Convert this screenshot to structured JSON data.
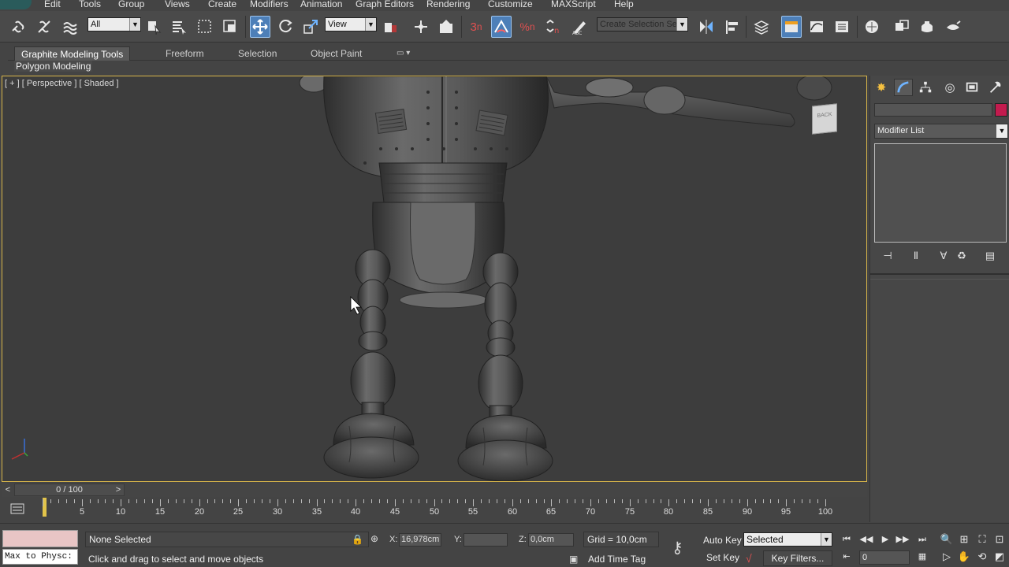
{
  "menu": {
    "items": [
      "Edit",
      "Tools",
      "Group",
      "Views",
      "Create",
      "Modifiers",
      "Animation",
      "Graph Editors",
      "Rendering",
      "Customize",
      "MAXScript",
      "Help"
    ]
  },
  "toolbar": {
    "selection_filter": "All",
    "ref_coord": "View",
    "named_selection": "Create Selection Se",
    "snap_label": "3",
    "angle_snap_label": "n",
    "percent_snap_label": "%"
  },
  "ribbon": {
    "tabs": [
      "Graphite Modeling Tools",
      "Freeform",
      "Selection",
      "Object Paint"
    ],
    "active_tab": "Graphite Modeling Tools",
    "sub_label": "Polygon Modeling"
  },
  "viewport": {
    "label": "[ + ] [ Perspective ] [ Shaded ]",
    "viewcube_face": "BACK"
  },
  "command_panel": {
    "modifier_list": "Modifier List",
    "color_swatch": "#c31b4e"
  },
  "timeslider": {
    "frame_display": "0 / 100",
    "prev": "<",
    "next": ">"
  },
  "trackbar": {
    "labels": [
      "5",
      "10",
      "15",
      "20",
      "25",
      "30",
      "35",
      "40",
      "45",
      "50",
      "55",
      "60",
      "65",
      "70",
      "75",
      "80",
      "85",
      "90",
      "95",
      "100"
    ]
  },
  "status": {
    "maxscript_text": "Max to Physc:",
    "selection": "None Selected",
    "prompt": "Click and drag to select and move objects",
    "x_label": "X:",
    "x_value": "16,978cm",
    "y_label": "Y:",
    "y_value": "",
    "z_label": "Z:",
    "z_value": "0,0cm",
    "grid": "Grid = 10,0cm",
    "add_time_tag": "Add Time Tag",
    "auto_key": "Auto Key",
    "set_key": "Set Key",
    "selected_dropdown": "Selected",
    "key_filters": "Key Filters...",
    "current_frame": "0"
  }
}
